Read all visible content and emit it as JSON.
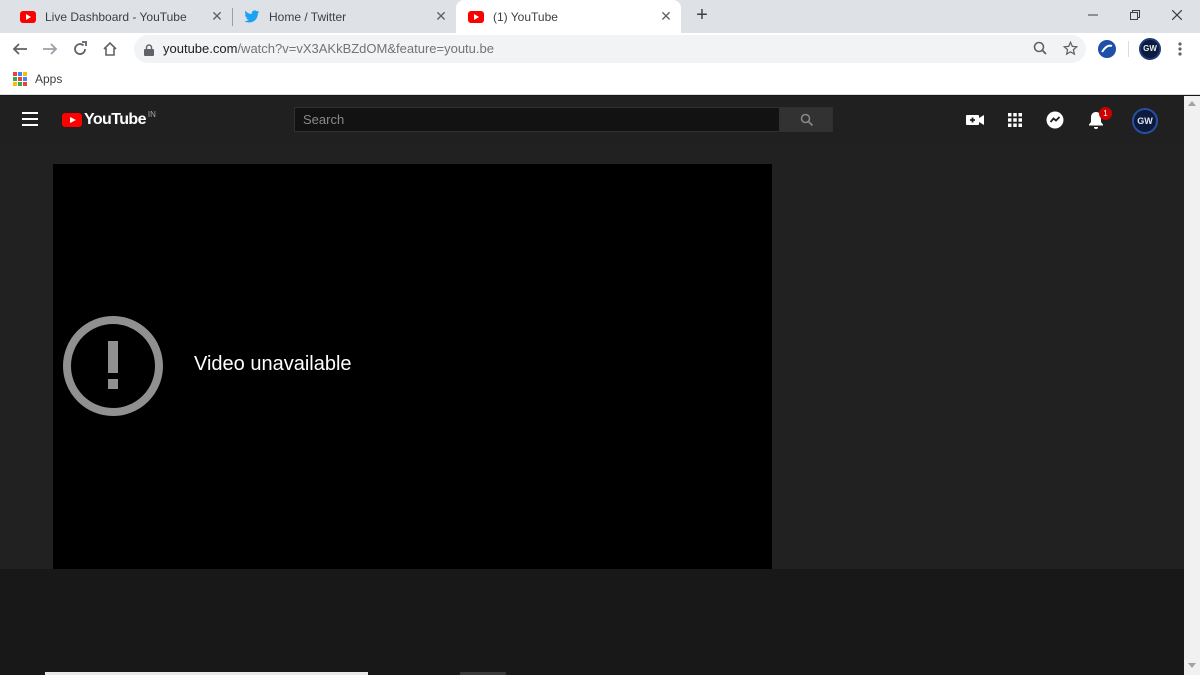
{
  "browser": {
    "tabs": [
      {
        "title": "Live Dashboard - YouTube",
        "favicon": "youtube-icon",
        "active": false
      },
      {
        "title": "Home / Twitter",
        "favicon": "twitter-icon",
        "active": false
      },
      {
        "title": "(1) YouTube",
        "favicon": "youtube-icon",
        "active": true
      }
    ],
    "close_glyph": "✕",
    "new_tab_glyph": "+",
    "url_host": "youtube.com",
    "url_rest": "/watch?v=vX3AKkBZdOM&feature=youtu.be",
    "profile_initials": "GW",
    "bookmarks": {
      "apps_label": "Apps"
    }
  },
  "youtube": {
    "logo_text": "YouTube",
    "country_code": "IN",
    "search_placeholder": "Search",
    "notification_count": "1",
    "avatar_initials": "GW",
    "player": {
      "error_message": "Video unavailable"
    }
  },
  "colors": {
    "youtube_red": "#ff0000",
    "twitter_blue": "#1da1f2",
    "header_bg": "#202020",
    "player_bg": "#000000",
    "error_icon_gray": "#909090"
  }
}
